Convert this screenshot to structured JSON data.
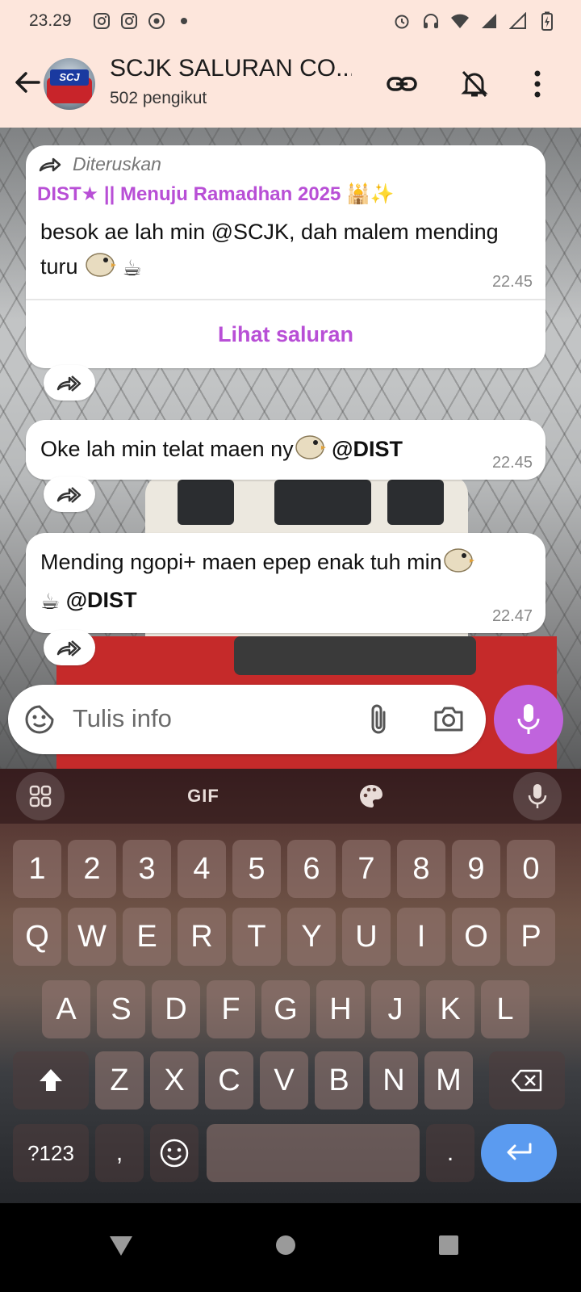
{
  "status_bar": {
    "time": "23.29"
  },
  "header": {
    "channel_title": "SCJK SALURAN CO...",
    "followers": "502 pengikut",
    "avatar_text": "SCJ"
  },
  "messages": [
    {
      "forwarded_label": "Diteruskan",
      "source_channel": "DIST★ || Menuju Ramadhan 2025 🕌✨",
      "text_line1": "besok ae lah min @SCJK, dah malem mending",
      "text_line2": "turu",
      "emoji": "☕",
      "time": "22.45",
      "view_channel_label": "Lihat saluran"
    },
    {
      "text": "Oke lah min telat maen ny",
      "mention": "@DIST",
      "time": "22.45"
    },
    {
      "text": "Mending ngopi+ maen epep enak tuh min",
      "emoji": "☕",
      "mention": "@DIST",
      "time": "22.47"
    }
  ],
  "input": {
    "placeholder": "Tulis info"
  },
  "keyboard": {
    "toolbar_gif": "GIF",
    "row_numbers": [
      "1",
      "2",
      "3",
      "4",
      "5",
      "6",
      "7",
      "8",
      "9",
      "0"
    ],
    "row1": [
      "Q",
      "W",
      "E",
      "R",
      "T",
      "Y",
      "U",
      "I",
      "O",
      "P"
    ],
    "row2": [
      "A",
      "S",
      "D",
      "F",
      "G",
      "H",
      "J",
      "K",
      "L"
    ],
    "row3": [
      "Z",
      "X",
      "C",
      "V",
      "B",
      "N",
      "M"
    ],
    "symbols_key": "?123",
    "comma_key": ",",
    "period_key": "."
  },
  "colors": {
    "header_bg": "#fde6dc",
    "accent_purple": "#c064dd",
    "channel_name_purple": "#b84fd6",
    "enter_key_blue": "#5b9bf0"
  }
}
